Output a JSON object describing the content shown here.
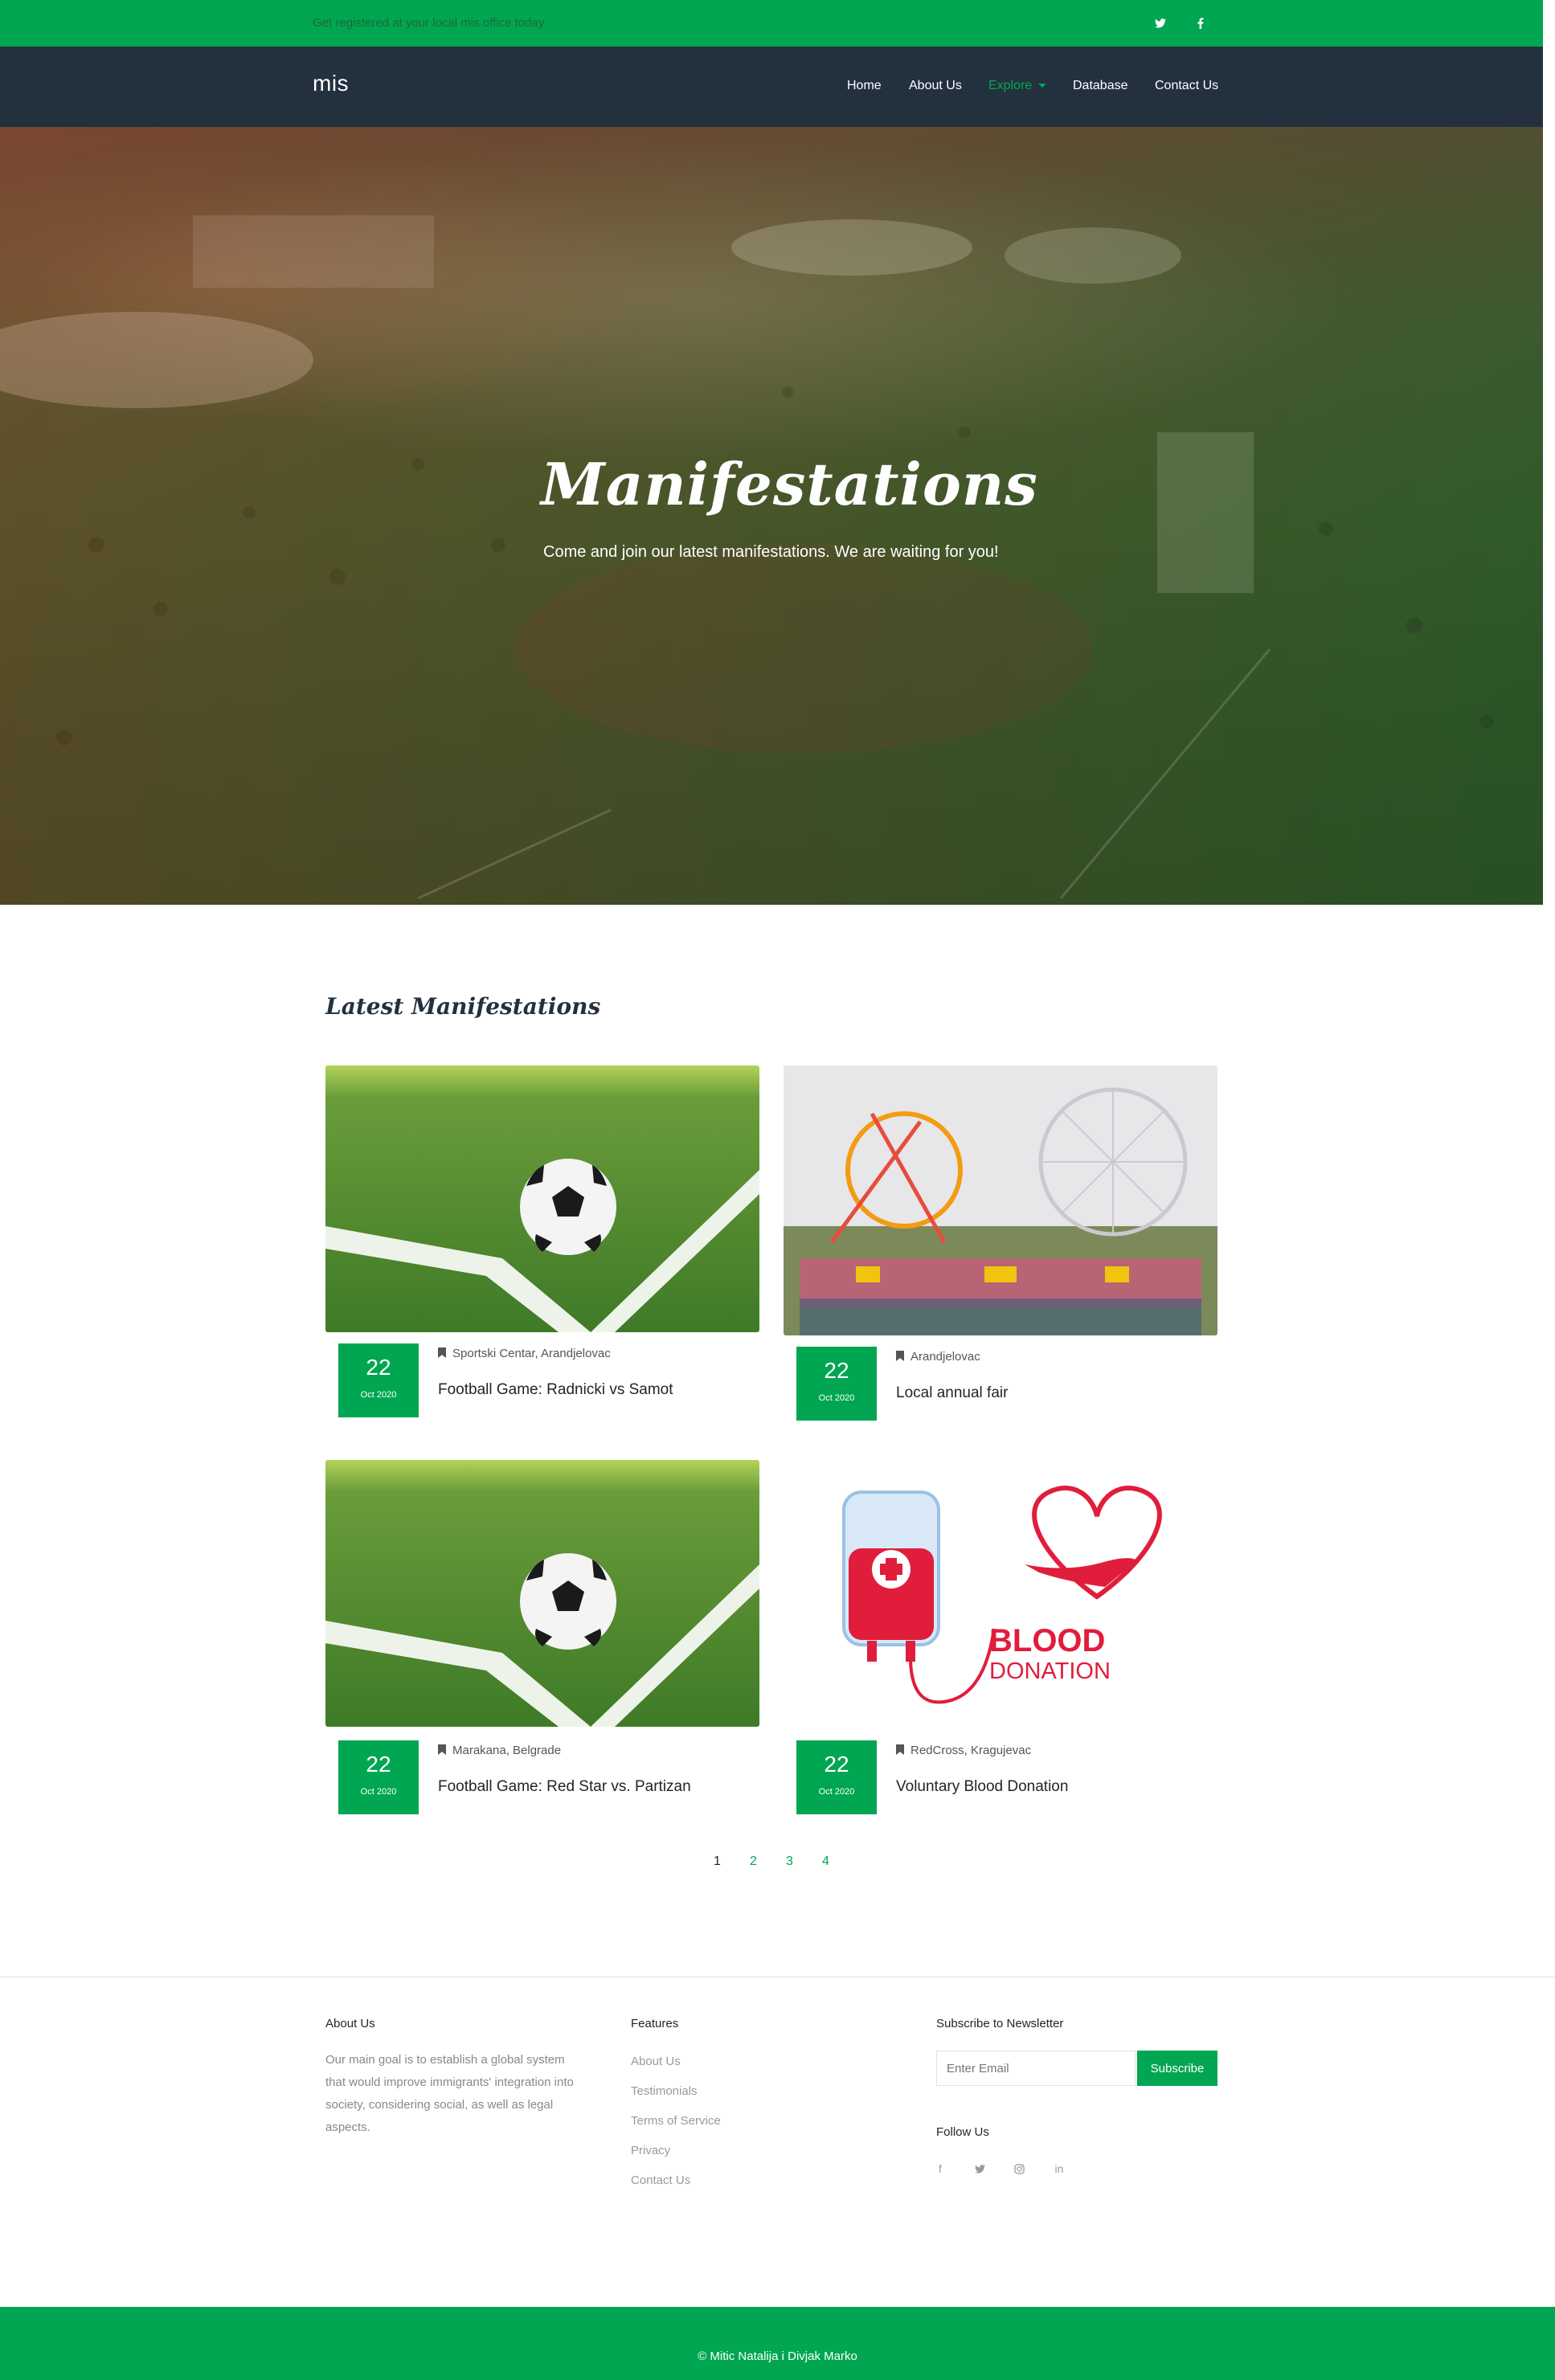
{
  "topbar": {
    "text": "Get registered at your local mis office today",
    "social": [
      "twitter-icon",
      "facebook-icon"
    ]
  },
  "nav": {
    "brand": "mis",
    "links": [
      "Home",
      "About Us",
      "Explore",
      "Database",
      "Contact Us"
    ],
    "active": "Explore"
  },
  "hero": {
    "title": "Manifestations",
    "subtitle": "Come and join our latest manifestations. We are waiting for you!"
  },
  "section": {
    "title": "Latest Manifestations"
  },
  "cards": [
    {
      "day": "22",
      "month": "Oct 2020",
      "location": "Sportski Centar, Arandjelovac",
      "title": "Football Game: Radnicki vs Samot",
      "image": "soccer-ball-image"
    },
    {
      "day": "22",
      "month": "Oct 2020",
      "location": "Arandjelovac",
      "title": "Local annual fair",
      "image": "ferris-wheel-fair-image"
    },
    {
      "day": "22",
      "month": "Oct 2020",
      "location": "Marakana, Belgrade",
      "title": "Football Game: Red Star vs. Partizan",
      "image": "soccer-ball-image"
    },
    {
      "day": "22",
      "month": "Oct 2020",
      "location": "RedCross, Kragujevac",
      "title": "Voluntary Blood Donation",
      "image": "blood-donation-image"
    }
  ],
  "blood_image": {
    "line1": "BLOOD",
    "line2": "DONATION"
  },
  "pagination": [
    "1",
    "2",
    "3",
    "4"
  ],
  "footer": {
    "about": {
      "heading": "About Us",
      "text": "Our main goal is to establish a global system that would improve immigrants' integration into society, considering social, as well as legal aspects."
    },
    "features": {
      "heading": "Features",
      "links": [
        "About Us",
        "Testimonials",
        "Terms of Service",
        "Privacy",
        "Contact Us"
      ]
    },
    "newsletter": {
      "heading": "Subscribe to Newsletter",
      "placeholder": "Enter Email",
      "button": "Subscribe"
    },
    "follow": {
      "heading": "Follow Us",
      "icons": [
        "facebook-icon",
        "twitter-icon",
        "instagram-icon",
        "linkedin-icon"
      ],
      "glyphs": [
        "f",
        "t",
        "◎",
        "in"
      ]
    },
    "copyright": "© Mitic Natalija i Divjak Marko"
  },
  "colors": {
    "brand_green": "#00a651",
    "navbar": "#23313f",
    "topbar_text": "#1e6b3a"
  }
}
